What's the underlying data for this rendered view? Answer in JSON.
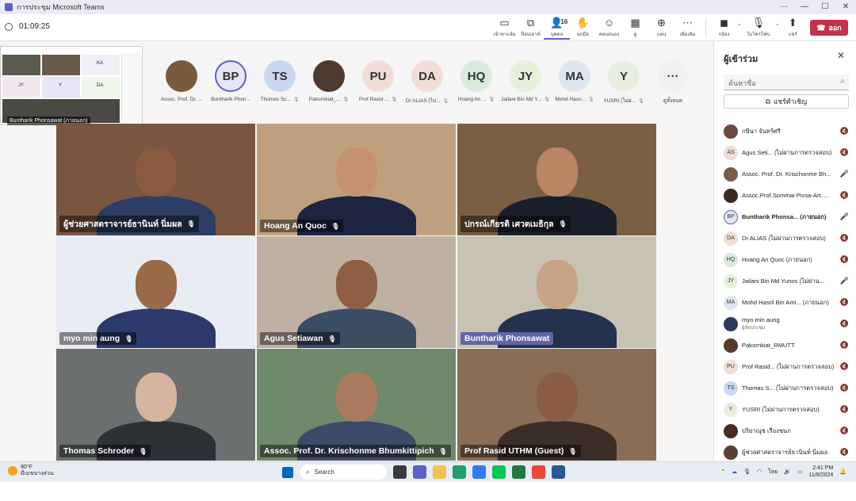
{
  "window": {
    "title": "การประชุม Microsoft Teams"
  },
  "toolbar": {
    "timer": "01:09:25",
    "tools": [
      {
        "name": "view",
        "icon": "▭",
        "label": "เข้าหาแล้ม"
      },
      {
        "name": "pip",
        "icon": "⧉",
        "label": "ป๊อปเอาท์"
      },
      {
        "name": "people",
        "icon": "👤",
        "label": "บุคคล",
        "count": "16",
        "active": true
      },
      {
        "name": "raise",
        "icon": "✋",
        "label": "ยกมือ"
      },
      {
        "name": "react",
        "icon": "☺",
        "label": "ตอบสนอง"
      },
      {
        "name": "rooms",
        "icon": "▦",
        "label": "ดู"
      },
      {
        "name": "apps",
        "icon": "⊕",
        "label": "แอป"
      },
      {
        "name": "more",
        "icon": "⋯",
        "label": "เพิ่มเติม"
      }
    ],
    "camera_label": "กล้อง",
    "mic_label": "ไมโครโฟน",
    "share_label": "แชร์",
    "leave_label": "ออก"
  },
  "thumbnail": {
    "caption": "Buntharik Phonsawat (ภายนอก)",
    "initials": [
      "KA",
      "JY",
      "Y",
      "DA"
    ]
  },
  "strip": [
    {
      "name": "Assoc. Prof. Dr. ...",
      "initials": "",
      "photo": "#7a5a3c",
      "mic": false
    },
    {
      "name": "Buntharik Phon...",
      "initials": "BP",
      "color": "#e6e6f5",
      "ring": true,
      "mic": false
    },
    {
      "name": "Thomas Sc...",
      "initials": "TS",
      "color": "#c9d7f0",
      "mic": true
    },
    {
      "name": "Pakornkiat_...",
      "initials": "",
      "photo": "#4d3b2f",
      "mic": true
    },
    {
      "name": "Prof Rasid ...",
      "initials": "PU",
      "color": "#f2ddd6",
      "mic": true
    },
    {
      "name": "Dr ALIAS (ไม่...",
      "initials": "DA",
      "color": "#f2ddd6",
      "mic": true
    },
    {
      "name": "Hoang An ...",
      "initials": "HQ",
      "color": "#d7ebdc",
      "mic": true
    },
    {
      "name": "Jailani Bin Md Y...",
      "initials": "JY",
      "color": "#e7f0d9",
      "mic": true
    },
    {
      "name": "Mohd Hasri...",
      "initials": "MA",
      "color": "#dde6ee",
      "mic": true
    },
    {
      "name": "YUSRI (ไม่ผ่...",
      "initials": "Y",
      "color": "#e8eedd",
      "mic": true
    },
    {
      "name": "ดูทั้งหมด",
      "initials": "···",
      "color": "#f0f0f0",
      "mic": false
    }
  ],
  "tiles": [
    {
      "name": "ผู้ช่วยศาสตราจารย์ธานินท์ นิ่มผล",
      "bg": "#7a5540",
      "face": "#8a5a3e",
      "body": "#2c3e63",
      "hl": false
    },
    {
      "name": "Hoang An Quoc",
      "bg": "#bfa07e",
      "face": "#c49172",
      "body": "#1c2440",
      "hl": false
    },
    {
      "name": "ปกรณ์เกียรติ เศวตเมธิกุล",
      "bg": "#7a5f42",
      "face": "#b98565",
      "body": "#1a1f2b",
      "hl": false
    },
    {
      "name": "myo min aung",
      "bg": "#e9edf3",
      "face": "#9a6a4a",
      "body": "#2b3a6a",
      "hl": false
    },
    {
      "name": "Agus Setiawan",
      "bg": "#bfb1a2",
      "face": "#8f5f44",
      "body": "#3a4d63",
      "hl": false
    },
    {
      "name": "Buntharik Phonsawat",
      "bg": "#c8c2b3",
      "face": "#c9a385",
      "body": "#22324f",
      "hl": true
    },
    {
      "name": "Thomas Schroder",
      "bg": "#6b6f70",
      "face": "#d7b4a0",
      "body": "#2e3133",
      "hl": false
    },
    {
      "name": "Assoc. Prof. Dr. Krischonme Bhumkittipich",
      "bg": "#6e8a6a",
      "face": "#a97c60",
      "body": "#3f4a66",
      "hl": false
    },
    {
      "name": "Prof Rasid UTHM (Guest)",
      "bg": "#8b6d55",
      "face": "#8a5c43",
      "body": "#3a2e27",
      "hl": false
    }
  ],
  "panel": {
    "title": "ผู้เข้าร่วม",
    "search_placeholder": "ค้นหาชื่อ",
    "share_invite": "แชร์คำเชิญ",
    "people": [
      {
        "name": "กษีนา จันทร์ศรี",
        "initials": "",
        "photo": "#6a4a3a",
        "mic": "off"
      },
      {
        "name": "Agus Seti... (ไม่ผ่านการตรวจสอบ)",
        "initials": "AS",
        "color": "#f2ddd6",
        "mic": "off"
      },
      {
        "name": "Assoc. Prof. Dr. Krischonme Bh...",
        "initials": "",
        "photo": "#7a5a4a",
        "mic": "on"
      },
      {
        "name": "Assoc.Prof.Sommai Pivsa-Art. ...",
        "initials": "",
        "photo": "#3a2a20",
        "mic": "off"
      },
      {
        "name": "Buntharik Phonsa... (ภายนอก)",
        "initials": "BP",
        "color": "#e6e6f5",
        "mic": "on",
        "bold": true
      },
      {
        "name": "Dr ALIAS (ไม่ผ่านการตรวจสอบ)",
        "initials": "DA",
        "color": "#f2ddd6",
        "mic": "off"
      },
      {
        "name": "Hoang An Quoc (ภายนอก)",
        "initials": "HQ",
        "color": "#d7ebdc",
        "mic": "off"
      },
      {
        "name": "Jailani Bin Md Yunos (ไม่ผ่าน...",
        "initials": "JY",
        "color": "#e7f0d9",
        "mic": "on"
      },
      {
        "name": "Mohd Hasril Bin Ami... (ภายนอก)",
        "initials": "MA",
        "color": "#dde6ee",
        "mic": "off"
      },
      {
        "name": "myo min aung",
        "sub": "ผู้จัดประชุม",
        "initials": "",
        "photo": "#2a3a5a",
        "mic": "off"
      },
      {
        "name": "Pakornkiat_RMUTT",
        "initials": "",
        "photo": "#5a3a2a",
        "mic": "off"
      },
      {
        "name": "Prof Rasid... (ไม่ผ่านการตรวจสอบ)",
        "initials": "PU",
        "color": "#f2ddd6",
        "mic": "off"
      },
      {
        "name": "Thomas S... (ไม่ผ่านการตรวจสอบ)",
        "initials": "TS",
        "color": "#c9d7f0",
        "mic": "off"
      },
      {
        "name": "YUSRI (ไม่ผ่านการตรวจสอบ)",
        "initials": "Y",
        "color": "#e8eedd",
        "mic": "off"
      },
      {
        "name": "ปริยาณุช เรืองชนก",
        "initials": "",
        "photo": "#4a2a22",
        "mic": "off"
      },
      {
        "name": "ผู้ช่วยศาสตราจารย์ธานินท์ นิ่มผล",
        "initials": "",
        "photo": "#5a4030",
        "mic": "off"
      }
    ]
  },
  "taskbar": {
    "weather_temp": "90°F",
    "weather_desc": "มีเมฆบางส่วน",
    "search_label": "Search",
    "time": "2:41 PM",
    "date": "11/8/2024",
    "lang": "ไทย"
  }
}
